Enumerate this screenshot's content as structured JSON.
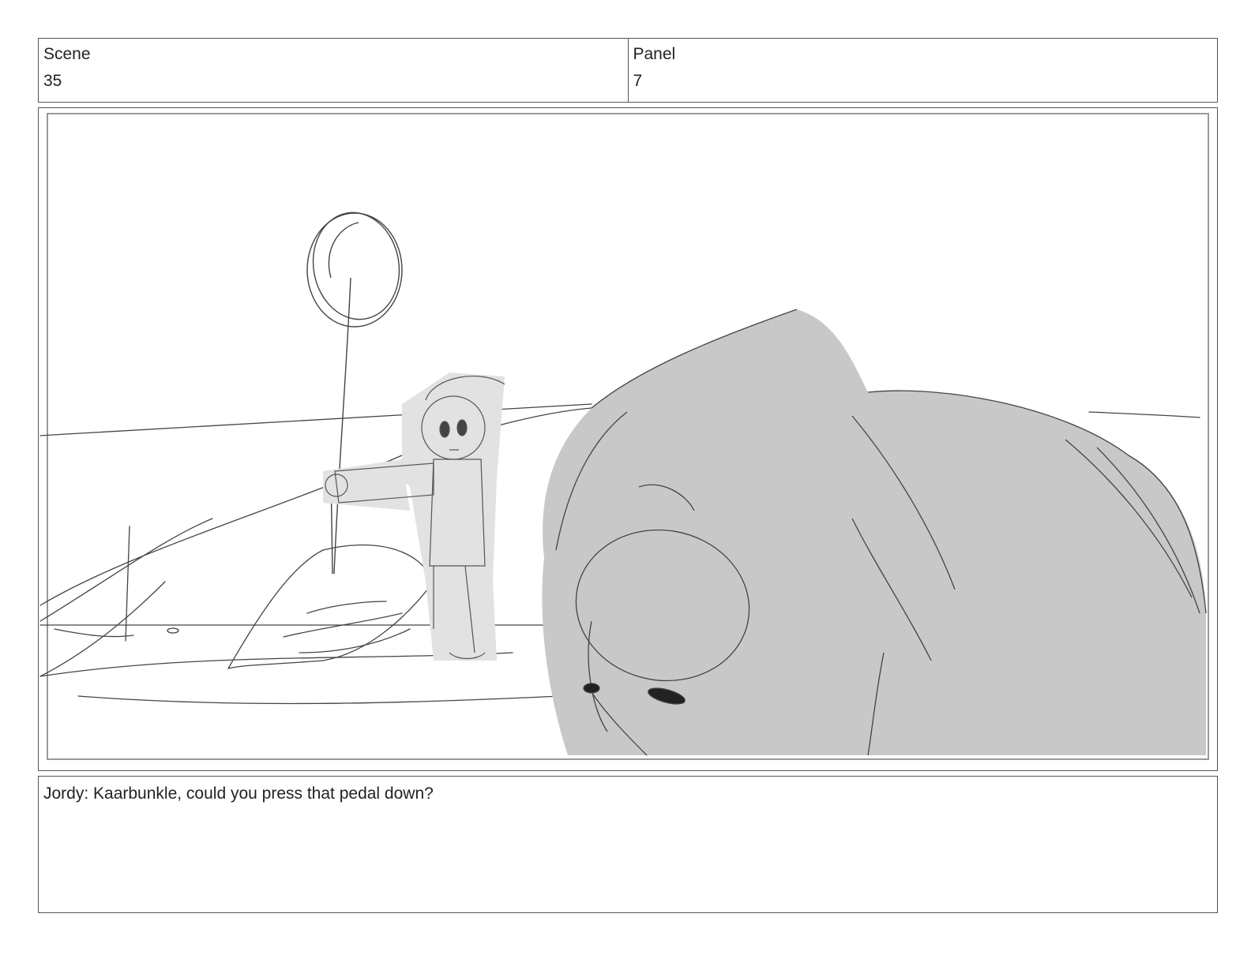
{
  "header": {
    "scene_label": "Scene",
    "scene_value": "35",
    "panel_label": "Panel",
    "panel_value": "7"
  },
  "caption": {
    "dialogue": "Jordy: Kaarbunkle, could you press that pedal down?"
  },
  "colors": {
    "border": "#555555",
    "sketch_line": "#444444",
    "creature_fill": "#c8c8c8",
    "character_fill": "#e2e2e2"
  }
}
